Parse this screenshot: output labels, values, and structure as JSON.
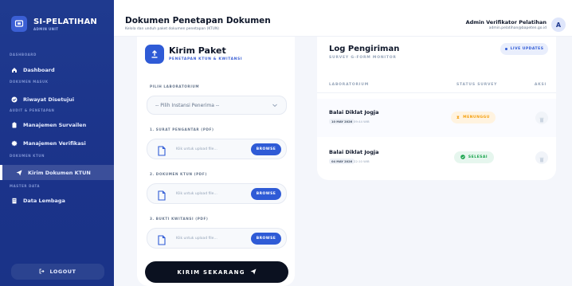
{
  "brand": {
    "title": "SI-PELATIHAN",
    "subtitle": "ADMIN UNIT"
  },
  "sidebar": {
    "sections": [
      {
        "label": "DASHBOARD",
        "items": [
          {
            "label": "Dashboard",
            "icon": "home-icon"
          }
        ]
      },
      {
        "label": "DOKUMEN MASUK",
        "items": [
          {
            "label": "Riwayat Disetujui",
            "icon": "check-circle-icon"
          }
        ]
      },
      {
        "label": "AUDIT & PENETAPAN",
        "items": [
          {
            "label": "Manajemen Survailen",
            "icon": "clipboard-icon"
          },
          {
            "label": "Manajemen Verifikasi",
            "icon": "badge-icon"
          }
        ]
      },
      {
        "label": "DOKUMEN KTUN",
        "items": [
          {
            "label": "Kirim Dokumen KTUN",
            "icon": "send-icon",
            "active": true
          }
        ]
      },
      {
        "label": "MASTER DATA",
        "items": [
          {
            "label": "Data Lembaga",
            "icon": "building-icon"
          }
        ]
      }
    ],
    "logout_label": "LOGOUT"
  },
  "header": {
    "title": "Dokumen Penetapan Dokumen",
    "subtitle": "Kelola dan unduh paket dokumen penetapan (KTUN)",
    "user_name": "Admin Verifikator Pelatihan",
    "user_email": "admin.pelatihan@bapeten.go.id",
    "avatar_initial": "A"
  },
  "form": {
    "title": "Kirim Paket",
    "subtitle": "PENETAPAN KTUN & KWITANSI",
    "lab_label": "PILIH LABORATORIUM",
    "lab_placeholder": "-- Pilih Instansi Penerima --",
    "uploads": [
      {
        "label": "1. SURAT PENGANTAR (PDF)",
        "placeholder": "Klik untuk upload file...",
        "button": "BROWSE"
      },
      {
        "label": "2. DOKUMEN KTUN (PDF)",
        "placeholder": "Klik untuk upload file...",
        "button": "BROWSE"
      },
      {
        "label": "3. BUKTI KWITANSI (PDF)",
        "placeholder": "Klik untuk upload file...",
        "button": "BROWSE"
      }
    ],
    "submit_label": "KIRIM SEKARANG"
  },
  "log": {
    "title": "Log Pengiriman",
    "subtitle": "SURVEY G-FORM MONITOR",
    "live_label": "LIVE UPDATES",
    "columns": [
      "LABORATORIUM",
      "STATUS SURVEY",
      "AKSI"
    ],
    "rows": [
      {
        "lab": "Balai Diklat Jogja",
        "date": "10 MAY 2026",
        "time": "09:44 WIB",
        "status": "MENUNGGU"
      },
      {
        "lab": "Balai Diklat Jogja",
        "date": "04 MAY 2026",
        "time": "22:10 WIB",
        "status": "SELESAI"
      }
    ]
  },
  "colors": {
    "primary": "#2f5bd6",
    "sidebar": "#1f3a8f",
    "warning": "#f59e0b",
    "success": "#16a34a",
    "dark": "#0b1120"
  }
}
